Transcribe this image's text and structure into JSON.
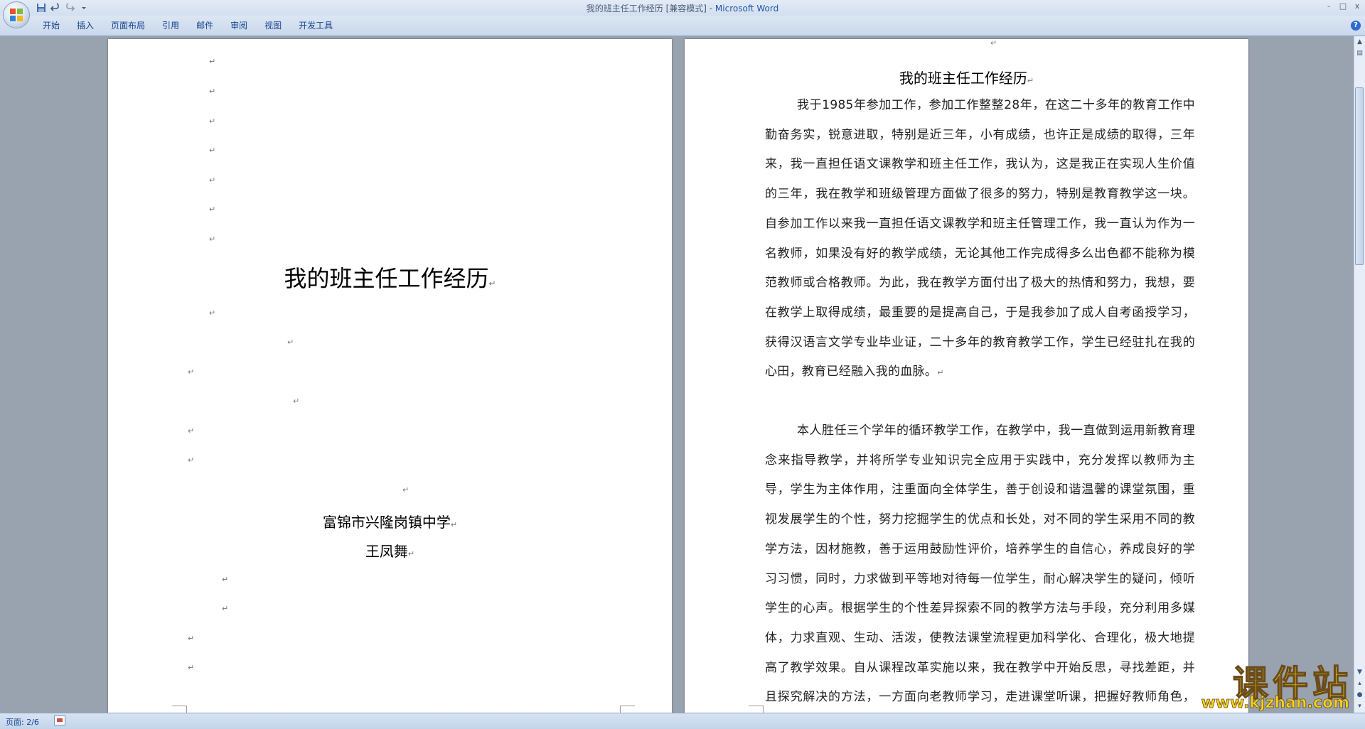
{
  "window": {
    "title_doc": "我的班主任工作经历 [兼容模式] - ",
    "title_app": "Microsoft Word",
    "controls": [
      "-",
      "□",
      "x"
    ]
  },
  "quick_access": {
    "icons": [
      "save-icon",
      "undo-icon",
      "redo-icon",
      "customize-qat-icon"
    ]
  },
  "ribbon": {
    "tabs": [
      "开始",
      "插入",
      "页面布局",
      "引用",
      "邮件",
      "审阅",
      "视图",
      "开发工具"
    ],
    "help": "?"
  },
  "left_page": {
    "cover_title": "我的班主任工作经历",
    "school": "富锦市兴隆岗镇中学",
    "author": "王凤舞",
    "paragraph_mark": "↵"
  },
  "right_page": {
    "title": "我的班主任工作经历",
    "paragraphs": [
      "我于1985年参加工作，参加工作整整28年，在这二十多年的教育工作中勤奋务实，锐意进取，特别是近三年，小有成绩，也许正是成绩的取得，三年来，我一直担任语文课教学和班主任工作，我认为，这是我正在实现人生价值的三年，我在教学和班级管理方面做了很多的努力，特别是教育教学这一块。自参加工作以来我一直担任语文课教学和班主任管理工作，我一直认为作为一名教师，如果没有好的教学成绩，无论其他工作完成得多么出色都不能称为模范教师或合格教师。为此，我在教学方面付出了极大的热情和努力，我想，要在教学上取得成绩，最重要的是提高自己，于是我参加了成人自考函授学习，获得汉语言文学专业毕业证，二十多年的教育教学工作，学生已经驻扎在我的心田，教育已经融入我的血脉。",
      "本人胜任三个学年的循环教学工作，在教学中，我一直做到运用新教育理念来指导教学，并将所学专业知识完全应用于实践中，充分发挥以教师为主导，学生为主体作用，注重面向全体学生，善于创设和谐温馨的课堂氛围，重视发展学生的个性，努力挖掘学生的优点和长处，对不同的学生采用不同的教学方法，因材施教，善于运用鼓励性评价，培养学生的自信心，养成良好的学习习惯，同时，力求做到平等地对待每一位学生，耐心解决学生的疑问，倾听学生的心声。根据学生的个性差异探索不同的教学方法与手段，充分利用多媒体，力求直观、生动、活泼，使教法课堂流程更加科学化、合理化，极大地提高了教学效果。自从课程改革实施以来，我在教学中开始反思，寻找差距，并且探究解决的方法，一方面向老教师学习，走进课堂听课，把握好教师角色，即教师是课堂教学中的指导者与"
    ]
  },
  "status_bar": {
    "page": "页面: 2/6"
  },
  "watermark": {
    "cn": "课件站",
    "url": "www.kjzhan.com"
  },
  "colors": {
    "ribbon_text": "#15428b",
    "app_title": "#1f57a8",
    "workspace_bg": "#99a3b0",
    "watermark_yellow": "#f3d21a"
  }
}
